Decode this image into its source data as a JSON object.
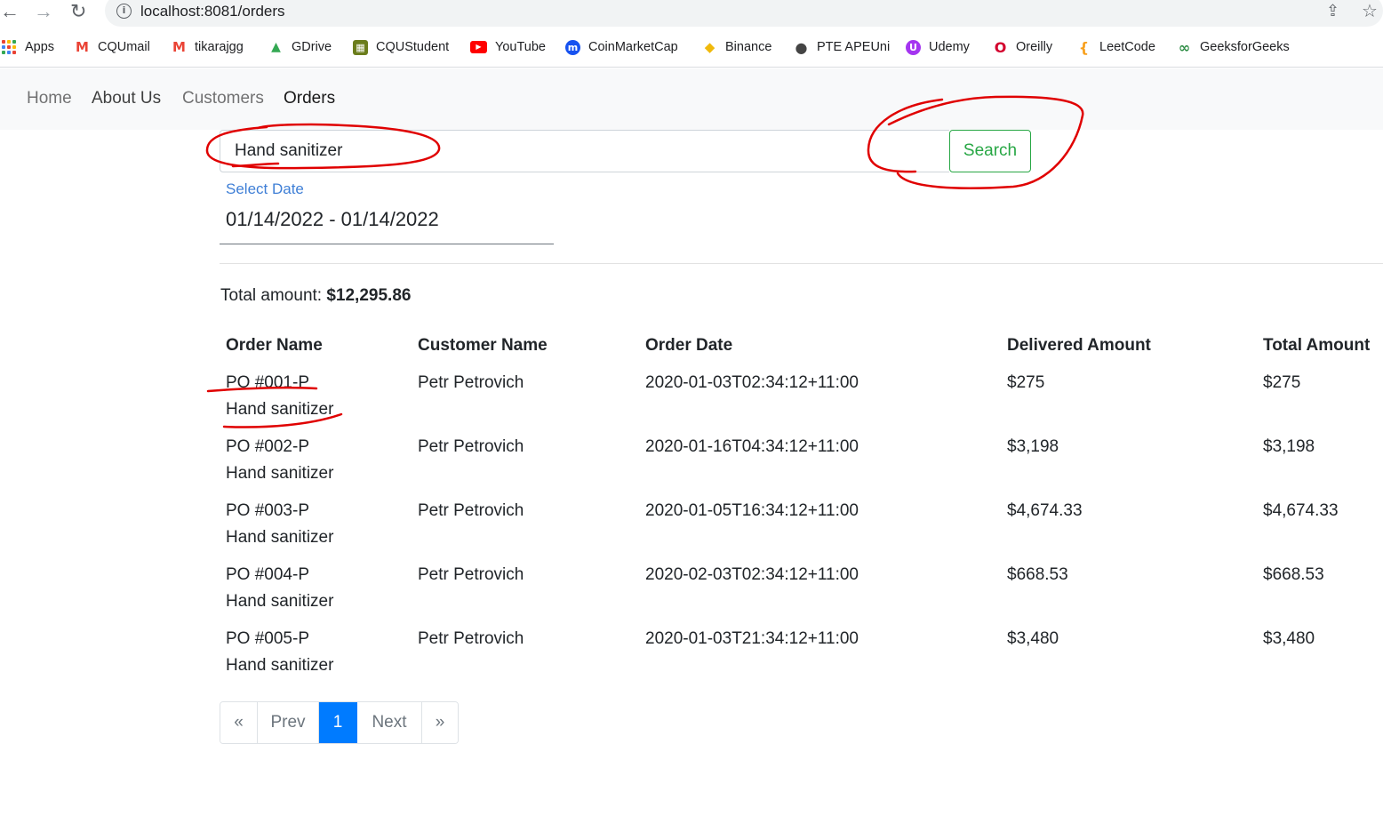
{
  "browser": {
    "url": "localhost:8081/orders",
    "bookmarks": [
      {
        "label": "Apps",
        "icon": "apps-grid-icon"
      },
      {
        "label": "CQUmail",
        "icon": "gmail-icon",
        "color": "#ea4335",
        "glyph": "M"
      },
      {
        "label": "tikarajgg",
        "icon": "gmail-icon",
        "color": "#ea4335",
        "glyph": "M"
      },
      {
        "label": "GDrive",
        "icon": "gdrive-icon",
        "color": "#34a853",
        "glyph": "▲"
      },
      {
        "label": "CQUStudent",
        "icon": "cqu-icon",
        "color": "#6b7d1c",
        "glyph": "▦"
      },
      {
        "label": "YouTube",
        "icon": "youtube-icon",
        "color": "#ff0000",
        "glyph": "▶"
      },
      {
        "label": "CoinMarketCap",
        "icon": "coinmarketcap-icon",
        "color": "#1752f0",
        "glyph": "m"
      },
      {
        "label": "Binance",
        "icon": "binance-icon",
        "color": "#f0b90b",
        "glyph": "◆"
      },
      {
        "label": "PTE APEUni",
        "icon": "apeuni-icon",
        "color": "#444444",
        "glyph": "●"
      },
      {
        "label": "Udemy",
        "icon": "udemy-icon",
        "color": "#a435f0",
        "glyph": "U"
      },
      {
        "label": "Oreilly",
        "icon": "oreilly-icon",
        "color": "#d3002d",
        "glyph": "O"
      },
      {
        "label": "LeetCode",
        "icon": "leetcode-icon",
        "color": "#f89f1b",
        "glyph": "{"
      },
      {
        "label": "GeeksforGeeks",
        "icon": "geeksforgeeks-icon",
        "color": "#2f8d46",
        "glyph": "∞"
      }
    ]
  },
  "nav": {
    "home": "Home",
    "about": "About Us",
    "customers": "Customers",
    "orders": "Orders"
  },
  "search": {
    "value": "Hand sanitizer",
    "button_label": "Search"
  },
  "date_filter": {
    "label": "Select Date",
    "value": "01/14/2022 - 01/14/2022"
  },
  "summary": {
    "total_label": "Total amount:",
    "total_value": "$12,295.86"
  },
  "table": {
    "headers": [
      "Order Name",
      "Customer Name",
      "Order Date",
      "Delivered Amount",
      "Total Amount"
    ],
    "rows": [
      {
        "order_no": "PO #001-P",
        "product": "Hand sanitizer",
        "customer": "Petr Petrovich",
        "date": "2020-01-03T02:34:12+11:00",
        "delivered": "$275",
        "total": "$275"
      },
      {
        "order_no": "PO #002-P",
        "product": "Hand sanitizer",
        "customer": "Petr Petrovich",
        "date": "2020-01-16T04:34:12+11:00",
        "delivered": "$3,198",
        "total": "$3,198"
      },
      {
        "order_no": "PO #003-P",
        "product": "Hand sanitizer",
        "customer": "Petr Petrovich",
        "date": "2020-01-05T16:34:12+11:00",
        "delivered": "$4,674.33",
        "total": "$4,674.33"
      },
      {
        "order_no": "PO #004-P",
        "product": "Hand sanitizer",
        "customer": "Petr Petrovich",
        "date": "2020-02-03T02:34:12+11:00",
        "delivered": "$668.53",
        "total": "$668.53"
      },
      {
        "order_no": "PO #005-P",
        "product": "Hand sanitizer",
        "customer": "Petr Petrovich",
        "date": "2020-01-03T21:34:12+11:00",
        "delivered": "$3,480",
        "total": "$3,480"
      }
    ]
  },
  "pagination": {
    "first": "«",
    "prev": "Prev",
    "current": "1",
    "next": "Next",
    "last": "»"
  },
  "colors": {
    "annotation": "#e00000",
    "success": "#28a745",
    "primary": "#007bff"
  }
}
